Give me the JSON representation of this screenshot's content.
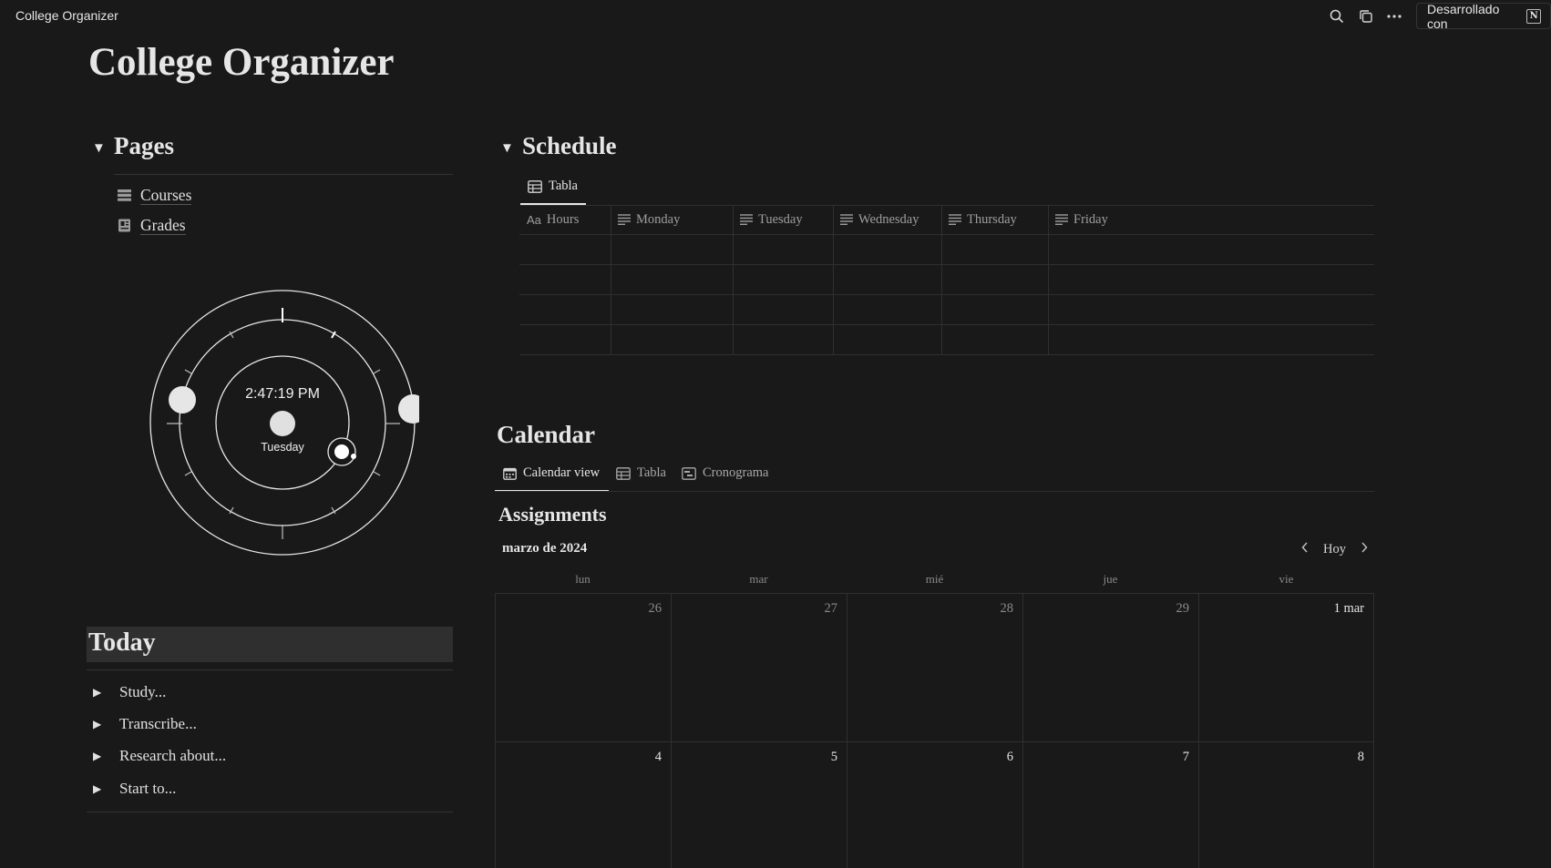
{
  "topbar": {
    "app_title": "College Organizer",
    "built_with": "Desarrollado con",
    "icons": [
      "search-icon",
      "duplicate-icon",
      "more-icon",
      "notion-logo-icon"
    ]
  },
  "page_title": "College Organizer",
  "pages": {
    "heading": "Pages",
    "items": [
      {
        "label": "Courses",
        "icon": "stack-icon"
      },
      {
        "label": "Grades",
        "icon": "notebook-icon"
      }
    ]
  },
  "clock": {
    "time": "2:47:19 PM",
    "day": "Tuesday"
  },
  "today": {
    "heading": "Today",
    "items": [
      "Study...",
      "Transcribe...",
      "Research about...",
      "Start to..."
    ]
  },
  "schedule": {
    "heading": "Schedule",
    "tab": "Tabla",
    "columns": [
      {
        "label": "Hours",
        "icon": "Aa"
      },
      {
        "label": "Monday",
        "icon": "text-icon"
      },
      {
        "label": "Tuesday",
        "icon": "text-icon"
      },
      {
        "label": "Wednesday",
        "icon": "text-icon"
      },
      {
        "label": "Thursday",
        "icon": "text-icon"
      },
      {
        "label": "Friday",
        "icon": "text-icon"
      }
    ]
  },
  "calendar": {
    "heading": "Calendar",
    "tabs": [
      "Calendar view",
      "Tabla",
      "Cronograma"
    ],
    "database_title": "Assignments",
    "month": "marzo de 2024",
    "today_button": "Hoy",
    "weekdays": [
      "lun",
      "mar",
      "mié",
      "jue",
      "vie"
    ],
    "weeks": [
      [
        "26",
        "27",
        "28",
        "29",
        "1 mar"
      ],
      [
        "4",
        "5",
        "6",
        "7",
        "8"
      ]
    ]
  },
  "colors": {
    "background": "#191919",
    "text": "#e6e6e6",
    "muted": "#8a8a8a",
    "divider": "#2f2f2f",
    "highlight": "#2f2f2f"
  }
}
